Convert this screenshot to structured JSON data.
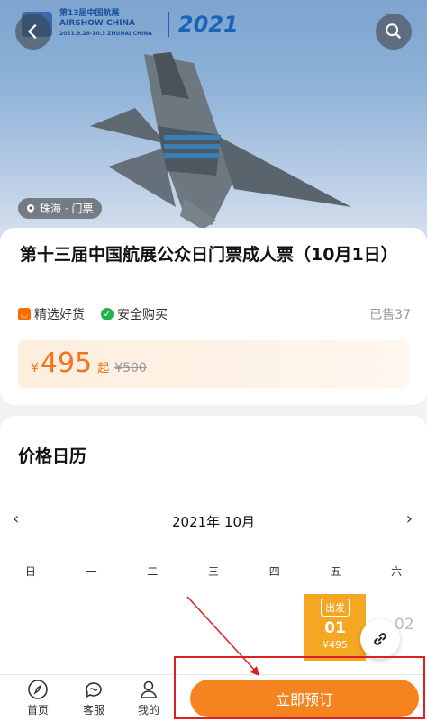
{
  "hero": {
    "brand_line1": "第13届中国航展",
    "brand_line2": "AIRSHOW CHINA",
    "brand_line3": "2021.9.28-10.3 ZHUHAI,CHINA",
    "brand_year": "2021",
    "location_tag": "珠海 · 门票",
    "icons": {
      "back": "back-arrow-icon",
      "search": "search-icon",
      "location": "location-pin-icon"
    }
  },
  "product": {
    "title": "第十三届中国航展公众日门票成人票（10月1日）",
    "tags": [
      {
        "label": "精选好货",
        "icon": "bag-icon",
        "color": "#ff6a00"
      },
      {
        "label": "安全购买",
        "icon": "shield-check-icon",
        "color": "#22b14c"
      }
    ],
    "sold": "已售37",
    "currency": "¥",
    "price": "495",
    "from_label": "起",
    "original_price": "¥500"
  },
  "calendar": {
    "title": "价格日历",
    "month": "2021年 10月",
    "prev": "‹",
    "next": "›",
    "weekdays": [
      "日",
      "一",
      "二",
      "三",
      "四",
      "五",
      "六"
    ],
    "selected_day": {
      "tag": "出发",
      "day": "01",
      "price": "¥495"
    },
    "next_day": "02"
  },
  "bottom_nav": {
    "home": "首页",
    "service": "客服",
    "mine": "我的",
    "book_button": "立即预订"
  },
  "colors": {
    "accent": "#f5831f",
    "price": "#f4731f",
    "annotation": "#e02020"
  }
}
